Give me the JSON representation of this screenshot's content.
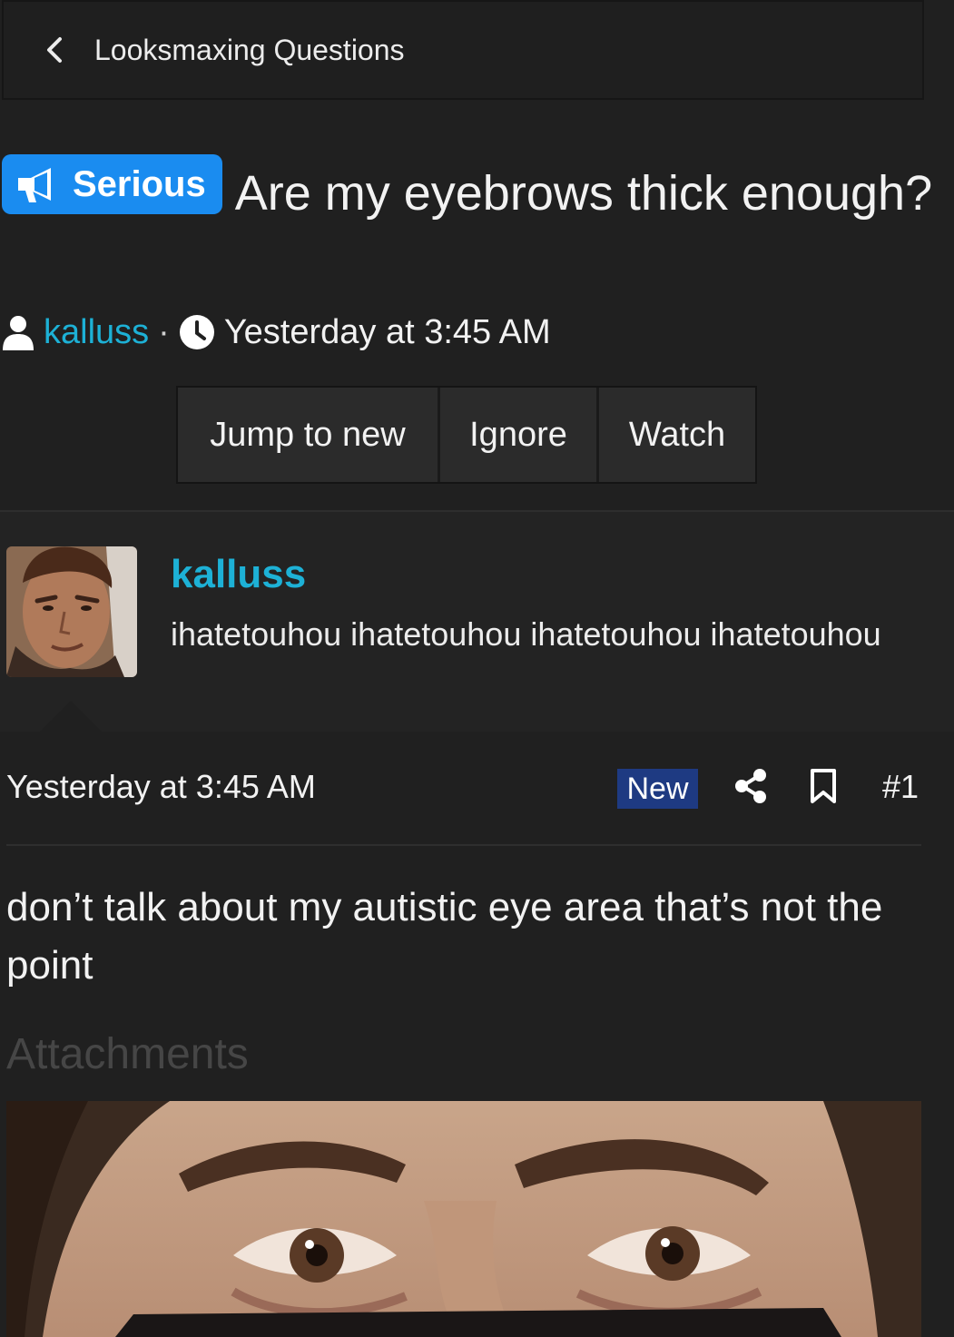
{
  "breadcrumb": {
    "label": "Looksmaxing Questions",
    "icon": "chevron-left-icon"
  },
  "thread": {
    "prefix": "Serious",
    "prefix_icon": "megaphone-icon",
    "title": "Are my eyebrows thick enough?",
    "author": "kalluss",
    "separator": "·",
    "time": "Yesterday at 3:45 AM"
  },
  "actions": {
    "jump": "Jump to new",
    "ignore": "Ignore",
    "watch": "Watch"
  },
  "user": {
    "name": "kalluss",
    "title": "ihatetouhou ihatetouhou ihatetouhou ihatetouhou"
  },
  "post": {
    "date": "Yesterday at 3:45 AM",
    "badge": "New",
    "number": "#1",
    "body": "don’t talk about my autistic eye area that’s not the point",
    "attachments_heading": "Attachments"
  },
  "colors": {
    "accent_link": "#1db1d6",
    "prefix_bg": "#1a8cf0",
    "new_badge_bg": "#1e3a82",
    "background": "#202020"
  }
}
